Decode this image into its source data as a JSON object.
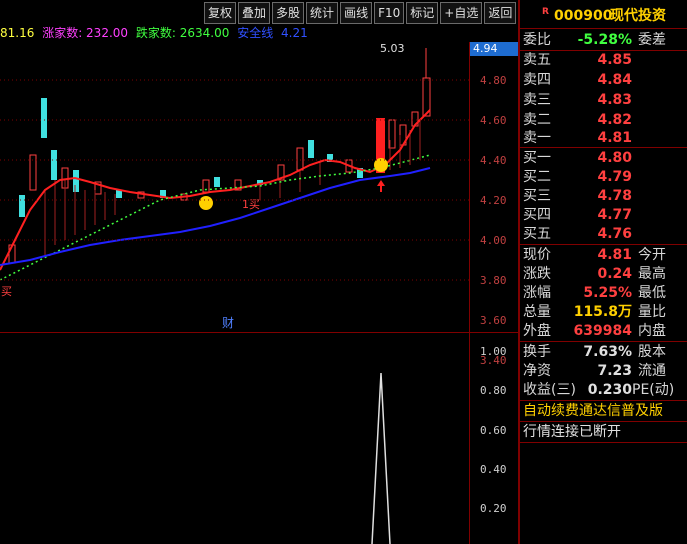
{
  "toolbar": {
    "items": [
      "复权",
      "叠加",
      "多股",
      "统计",
      "画线",
      "F10",
      "标记",
      "+自选",
      "返回"
    ]
  },
  "legend": {
    "partial": "81.16",
    "up_label": "涨家数: 232.00",
    "down_label": "跌家数: 2634.00",
    "safe_label": "安全线",
    "safe_value": "4.21"
  },
  "annotations": {
    "peak_price": "5.03",
    "buy1": "买",
    "buy2": "1买",
    "finance": "财",
    "current_price_box": "4.94"
  },
  "y_axis_main": [
    "4.80",
    "4.60",
    "4.40",
    "4.20",
    "4.00",
    "3.80",
    "3.60",
    "3.40"
  ],
  "y_axis_sub": [
    "1.00",
    "0.80",
    "0.60",
    "0.40",
    "0.20"
  ],
  "quote": {
    "tag": "R",
    "code": "000900",
    "name": "现代投资",
    "weibi_label": "委比",
    "weibi_value": "-5.28%",
    "weicha_label": "委差",
    "sell": [
      {
        "label": "卖五",
        "price": "4.85"
      },
      {
        "label": "卖四",
        "price": "4.84"
      },
      {
        "label": "卖三",
        "price": "4.83"
      },
      {
        "label": "卖二",
        "price": "4.82"
      },
      {
        "label": "卖一",
        "price": "4.81"
      }
    ],
    "buy": [
      {
        "label": "买一",
        "price": "4.80"
      },
      {
        "label": "买二",
        "price": "4.79"
      },
      {
        "label": "买三",
        "price": "4.78"
      },
      {
        "label": "买四",
        "price": "4.77"
      },
      {
        "label": "买五",
        "price": "4.76"
      }
    ],
    "stats": [
      {
        "label": "现价",
        "value": "4.81",
        "label2": "今开"
      },
      {
        "label": "涨跌",
        "value": "0.24",
        "label2": "最高"
      },
      {
        "label": "涨幅",
        "value": "5.25%",
        "label2": "最低"
      },
      {
        "label": "总量",
        "value": "115.8万",
        "label2": "量比"
      },
      {
        "label": "外盘",
        "value": "639984",
        "label2": "内盘"
      }
    ],
    "fin": [
      {
        "label": "换手",
        "value": "7.63%",
        "label2": "股本"
      },
      {
        "label": "净资",
        "value": "7.23",
        "label2": "流通"
      },
      {
        "label": "收益(三)",
        "value": "0.230",
        "label2": "PE(动)"
      }
    ],
    "promo": "自动续费通达信普及版",
    "status": "行情连接已断开"
  },
  "colors": {
    "up": "#ff4040",
    "down": "#40e0e0",
    "ma_red": "#ff2020",
    "ma_blue": "#2020ff",
    "ma_green": "#40ff40",
    "grid": "#800000"
  }
}
